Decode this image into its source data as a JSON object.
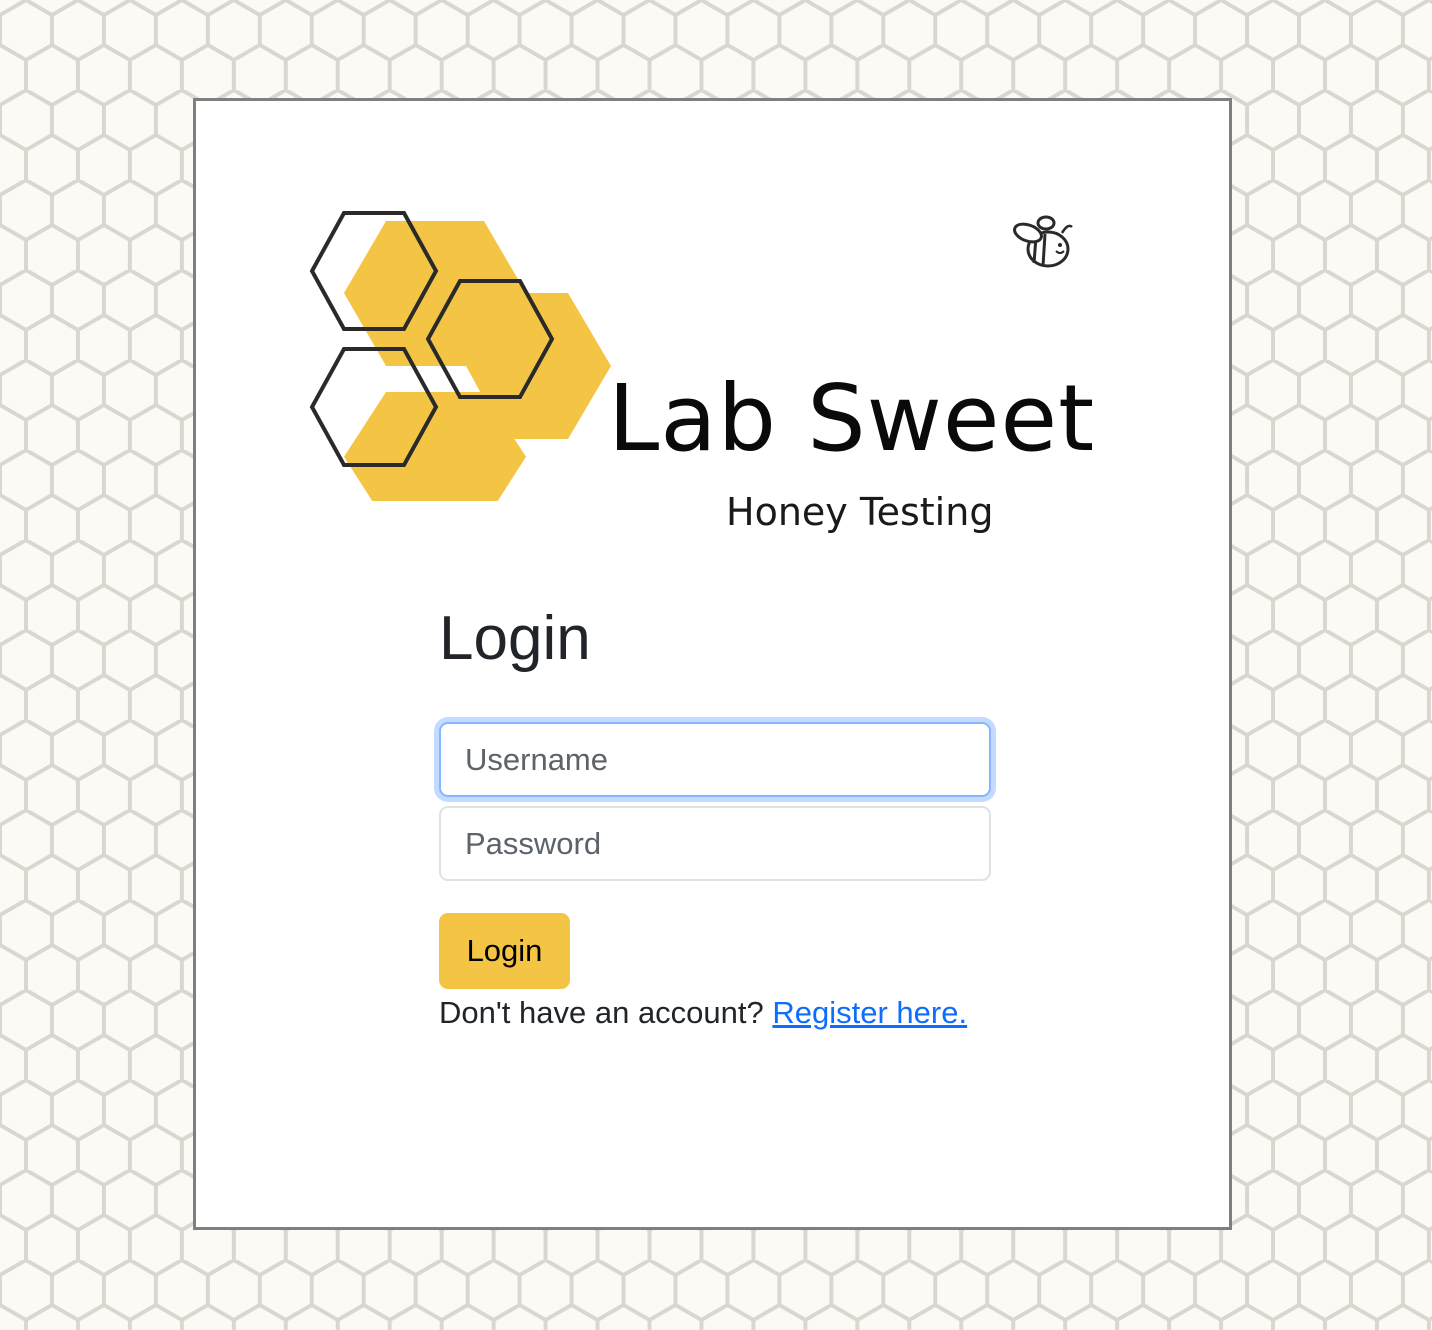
{
  "logo": {
    "title": "Lab Sweet",
    "subtitle": "Honey Testing",
    "accent_color": "#f4c544",
    "icon": "bee-icon"
  },
  "login_form": {
    "heading": "Login",
    "username_placeholder": "Username",
    "password_placeholder": "Password",
    "submit_label": "Login",
    "register_prompt": "Don't have an account?",
    "register_link": "Register here."
  },
  "colors": {
    "background": "#fcfaf4",
    "honeycomb_lines": "#dcdcd6",
    "button": "#f4c544",
    "link": "#0d6efd"
  }
}
